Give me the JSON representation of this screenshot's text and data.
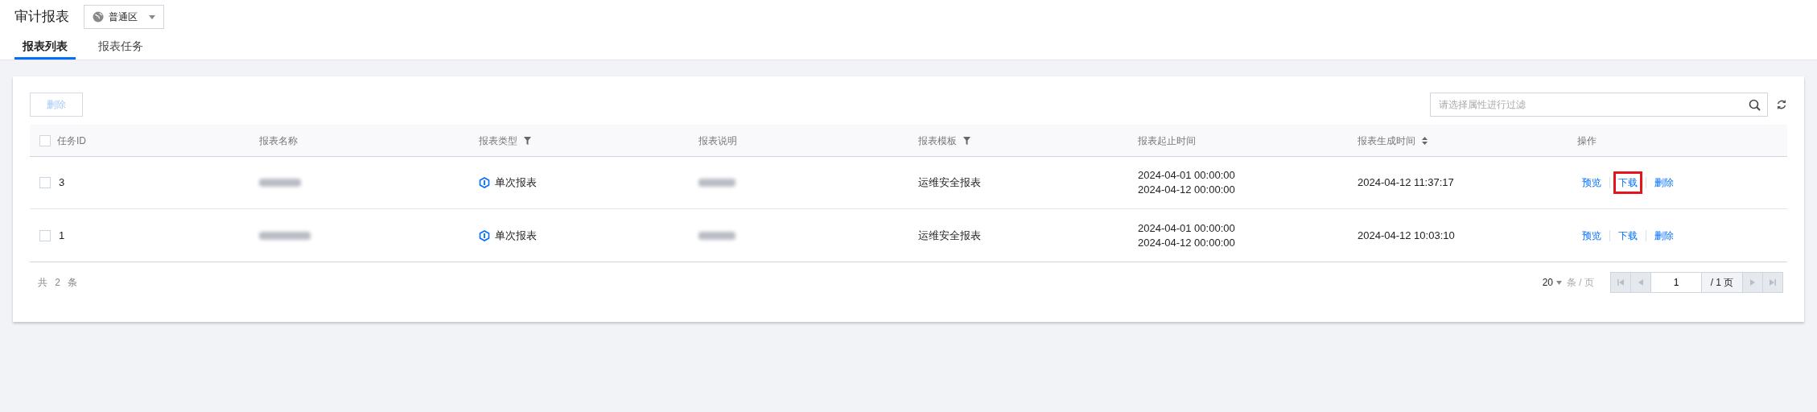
{
  "page_title": "审计报表",
  "region_select": {
    "value": "普通区"
  },
  "tabs": [
    {
      "label": "报表列表",
      "selected": true
    },
    {
      "label": "报表任务",
      "selected": false
    }
  ],
  "toolbar": {
    "delete_button": {
      "label": "删除",
      "disabled": true
    },
    "search": {
      "placeholder": "请选择属性进行过滤"
    }
  },
  "table": {
    "header_checked": false,
    "columns": [
      {
        "label": "任务ID",
        "kind": "checkbox"
      },
      {
        "label": "报表名称",
        "kind": "plain"
      },
      {
        "label": "报表类型",
        "kind": "filter"
      },
      {
        "label": "报表说明",
        "kind": "plain"
      },
      {
        "label": "报表模板",
        "kind": "filter"
      },
      {
        "label": "报表起止时间",
        "kind": "plain"
      },
      {
        "label": "报表生成时间",
        "kind": "sort"
      },
      {
        "label": "操作",
        "kind": "plain"
      }
    ],
    "rows": [
      {
        "checked": false,
        "id": "3",
        "name": {
          "kind": "redacted"
        },
        "type": "单次报表",
        "description": {
          "kind": "redacted"
        },
        "template": "运维安全报表",
        "period": [
          "2024-04-01 00:00:00",
          "2024-04-12 00:00:00"
        ],
        "generated": "2024-04-12 11:37:17",
        "actions": [
          {
            "label": "预览",
            "highlighted": false
          },
          {
            "label": "下载",
            "highlighted": true
          },
          {
            "label": "删除",
            "highlighted": false
          }
        ]
      },
      {
        "checked": false,
        "id": "1",
        "name": {
          "kind": "redacted"
        },
        "type": "单次报表",
        "description": {
          "kind": "redacted"
        },
        "template": "运维安全报表",
        "period": [
          "2024-04-01 00:00:00",
          "2024-04-12 00:00:00"
        ],
        "generated": "2024-04-12 10:03:10",
        "actions": [
          {
            "label": "预览",
            "highlighted": false
          },
          {
            "label": "下载",
            "highlighted": false
          },
          {
            "label": "删除",
            "highlighted": false
          }
        ]
      }
    ]
  },
  "pagination": {
    "total": "共 2 条",
    "page_size": "20",
    "page_size_unit": "条 / 页",
    "page": "1",
    "page_count": "/ 1 页"
  }
}
